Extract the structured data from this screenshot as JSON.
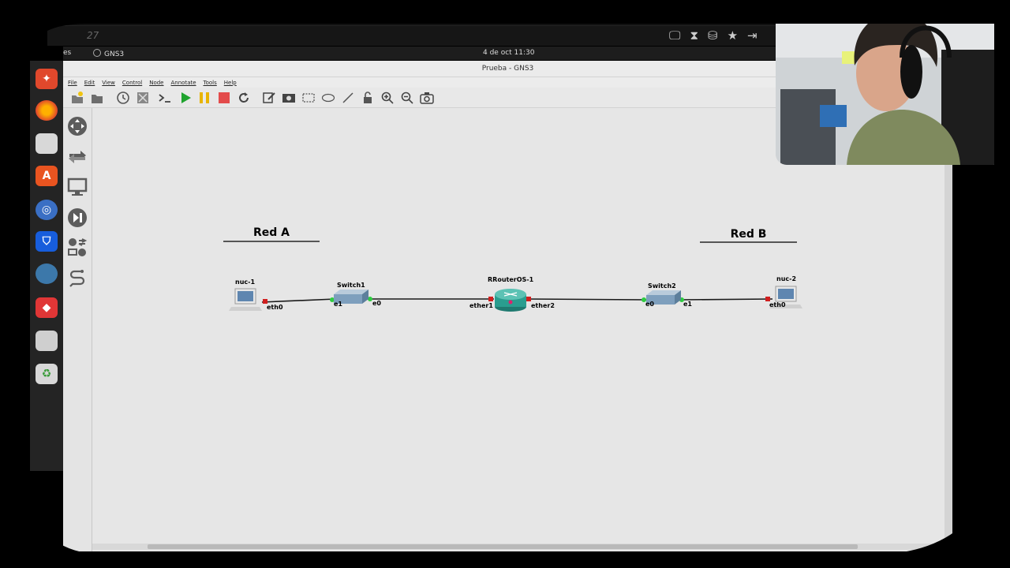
{
  "background": {
    "tab_title": "…27",
    "bar2_text": "27"
  },
  "gnome": {
    "activities": "es",
    "app_name": "GNS3",
    "clock": "4 de oct  11:30"
  },
  "gns3": {
    "window_title": "Prueba - GNS3",
    "menu": [
      "File",
      "Edit",
      "View",
      "Control",
      "Node",
      "Annotate",
      "Tools",
      "Help"
    ]
  },
  "topology": {
    "notes": [
      "Red A",
      "Red B"
    ],
    "nodes": {
      "nuc1": "nuc-1",
      "switch1": "Switch1",
      "router": "RRouterOS-1",
      "switch2": "Switch2",
      "nuc2": "nuc-2"
    },
    "ports": {
      "nuc1_eth0": "eth0",
      "sw1_e1": "e1",
      "sw1_e0": "e0",
      "r_ether1": "ether1",
      "r_ether2": "ether2",
      "sw2_e0": "e0",
      "sw2_e1": "e1",
      "nuc2_eth0": "eth0"
    }
  },
  "colors": {
    "link_up": "#2ecc40",
    "link_down": "#d01f1f",
    "router": "#2a9d8f"
  }
}
